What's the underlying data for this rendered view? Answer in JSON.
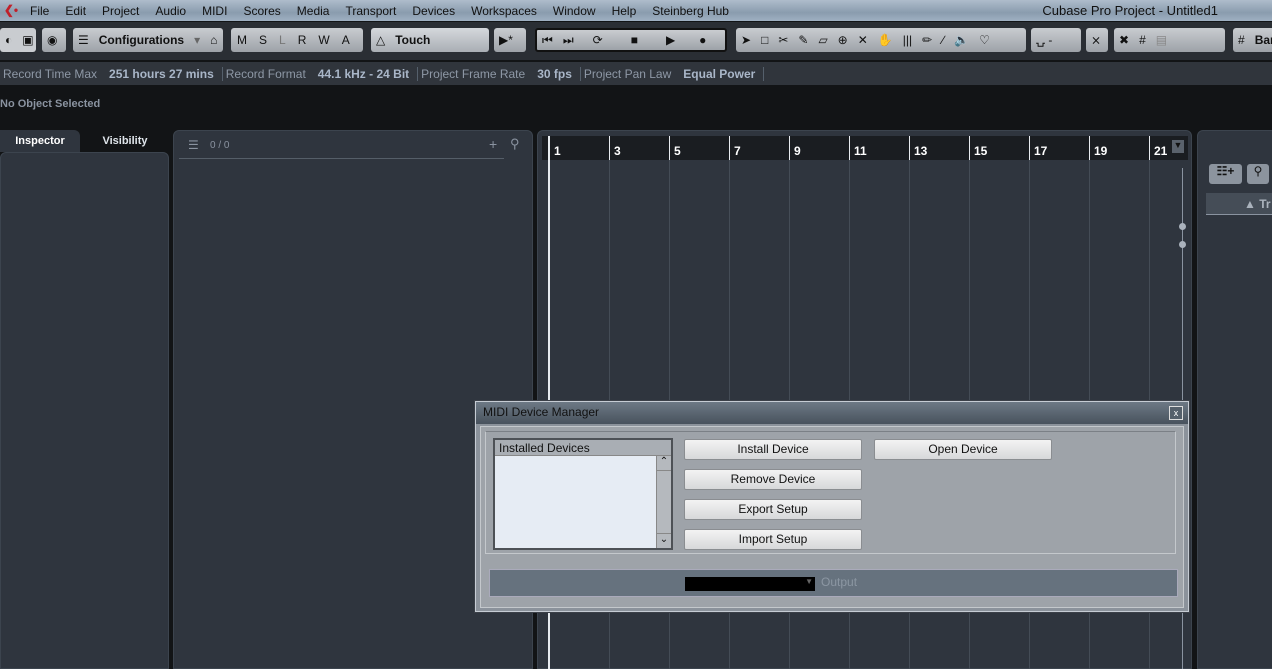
{
  "window": {
    "title": "Cubase Pro Project - Untitled1"
  },
  "menu": [
    "File",
    "Edit",
    "Project",
    "Audio",
    "MIDI",
    "Scores",
    "Media",
    "Transport",
    "Devices",
    "Workspaces",
    "Window",
    "Help",
    "Steinberg Hub"
  ],
  "toolbar": {
    "configurations": "Configurations",
    "automation_buttons": [
      "M",
      "S",
      "L",
      "R",
      "W",
      "A"
    ],
    "automation_mode": "Touch",
    "grid_type": "Bar"
  },
  "infobar": [
    {
      "label": "Record Time Max",
      "value": "251 hours 27 mins"
    },
    {
      "label": "Record Format",
      "value": "44.1 kHz - 24 Bit"
    },
    {
      "label": "Project Frame Rate",
      "value": "30 fps"
    },
    {
      "label": "Project Pan Law",
      "value": "Equal Power"
    }
  ],
  "status": "No Object Selected",
  "inspector_tabs": [
    "Inspector",
    "Visibility"
  ],
  "track_list": {
    "count": "0 / 0"
  },
  "ruler": [
    "1",
    "3",
    "5",
    "7",
    "9",
    "11",
    "13",
    "15",
    "17",
    "19",
    "21"
  ],
  "right_zone": {
    "header": "Tr"
  },
  "dialog": {
    "title": "MIDI Device Manager",
    "close": "x",
    "list_header": "Installed Devices",
    "buttons": {
      "install": "Install Device",
      "open": "Open Device",
      "remove": "Remove Device",
      "export": "Export Setup",
      "import": "Import Setup"
    },
    "output_label": "Output"
  }
}
